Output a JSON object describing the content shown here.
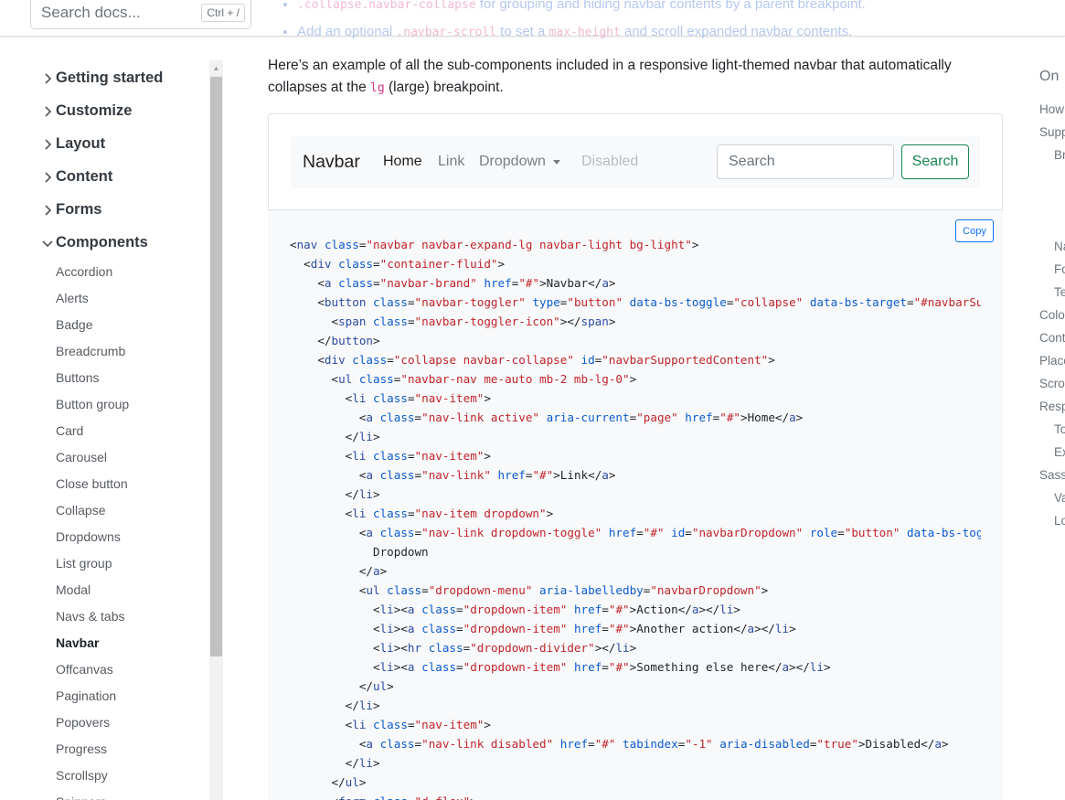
{
  "search": {
    "placeholder": "Search docs...",
    "shortcut": "Ctrl + /"
  },
  "top_bullets": {
    "b1_code": ".collapse.navbar-collapse",
    "b1_text": " for grouping and hiding navbar contents by a parent breakpoint.",
    "b2_pre": "Add an optional ",
    "b2_code1": ".navbar-scroll",
    "b2_mid": " to set a ",
    "b2_code2": "max-height",
    "b2_post": " and scroll expanded navbar contents."
  },
  "sidebar": {
    "groups": [
      {
        "label": "Getting started",
        "expanded": false
      },
      {
        "label": "Customize",
        "expanded": false
      },
      {
        "label": "Layout",
        "expanded": false
      },
      {
        "label": "Content",
        "expanded": false
      },
      {
        "label": "Forms",
        "expanded": false
      },
      {
        "label": "Components",
        "expanded": true
      }
    ],
    "items": [
      "Accordion",
      "Alerts",
      "Badge",
      "Breadcrumb",
      "Buttons",
      "Button group",
      "Card",
      "Carousel",
      "Close button",
      "Collapse",
      "Dropdowns",
      "List group",
      "Modal",
      "Navs & tabs",
      "Navbar",
      "Offcanvas",
      "Pagination",
      "Popovers",
      "Progress",
      "Scrollspy",
      "Spinners"
    ],
    "active_item": "Navbar"
  },
  "intro": {
    "text1": "Here’s an example of all the sub-components included in a responsive light-themed navbar that automatically collapses at the ",
    "code": "lg",
    "text2": " (large) breakpoint."
  },
  "example_navbar": {
    "brand": "Navbar",
    "links": {
      "home": "Home",
      "link": "Link",
      "dropdown": "Dropdown",
      "disabled": "Disabled"
    },
    "search_placeholder": "Search",
    "search_button": "Search"
  },
  "code_block": {
    "copy_label": "Copy"
  },
  "toc": {
    "title": "On",
    "items": [
      "How",
      "Supp",
      "Br",
      "Na",
      "Fo",
      "Te",
      "Colo",
      "Cont",
      "Place",
      "Scro",
      "Resp",
      "To",
      "Ex",
      "Sass",
      "Va",
      "Lo"
    ]
  }
}
